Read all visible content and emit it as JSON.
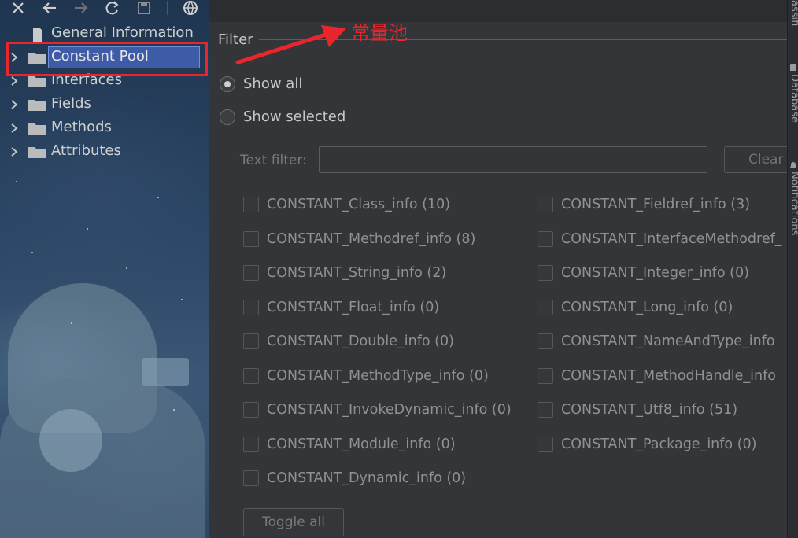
{
  "toolbar": {
    "icons": [
      "close-icon",
      "back-icon",
      "forward-icon",
      "refresh-icon",
      "save-icon",
      "globe-icon"
    ]
  },
  "tree": {
    "items": [
      {
        "label": "General Information",
        "icon": "file-icon",
        "expandable": false,
        "selected": false
      },
      {
        "label": "Constant Pool",
        "icon": "folder-icon",
        "expandable": true,
        "selected": true
      },
      {
        "label": "Interfaces",
        "icon": "folder-icon",
        "expandable": true,
        "selected": false
      },
      {
        "label": "Fields",
        "icon": "folder-icon",
        "expandable": true,
        "selected": false
      },
      {
        "label": "Methods",
        "icon": "folder-icon",
        "expandable": true,
        "selected": false
      },
      {
        "label": "Attributes",
        "icon": "folder-icon",
        "expandable": true,
        "selected": false
      }
    ]
  },
  "filter": {
    "title": "Filter",
    "show_all": "Show all",
    "show_selected": "Show selected",
    "selected_option": "show_all",
    "text_filter_label": "Text filter:",
    "text_filter_value": "",
    "clear_label": "Clear",
    "toggle_all_label": "Toggle all",
    "left_column": [
      "CONSTANT_Class_info (10)",
      "CONSTANT_Methodref_info (8)",
      "CONSTANT_String_info (2)",
      "CONSTANT_Float_info (0)",
      "CONSTANT_Double_info (0)",
      "CONSTANT_MethodType_info (0)",
      "CONSTANT_InvokeDynamic_info (0)",
      "CONSTANT_Module_info (0)",
      "CONSTANT_Dynamic_info (0)"
    ],
    "right_column": [
      "CONSTANT_Fieldref_info (3)",
      "CONSTANT_InterfaceMethodref_",
      "CONSTANT_Integer_info (0)",
      "CONSTANT_Long_info (0)",
      "CONSTANT_NameAndType_info",
      "CONSTANT_MethodHandle_info",
      "CONSTANT_Utf8_info (51)",
      "CONSTANT_Package_info (0)"
    ]
  },
  "right_strip": {
    "top_label": "assifi",
    "database_label": "Database",
    "notifications_label": "Notifications"
  },
  "annotation": {
    "text": "常量池",
    "color": "#e8262b"
  },
  "colors": {
    "selection": "#3d5ba6",
    "panel": "#333538",
    "highlight": "#e8262b"
  }
}
